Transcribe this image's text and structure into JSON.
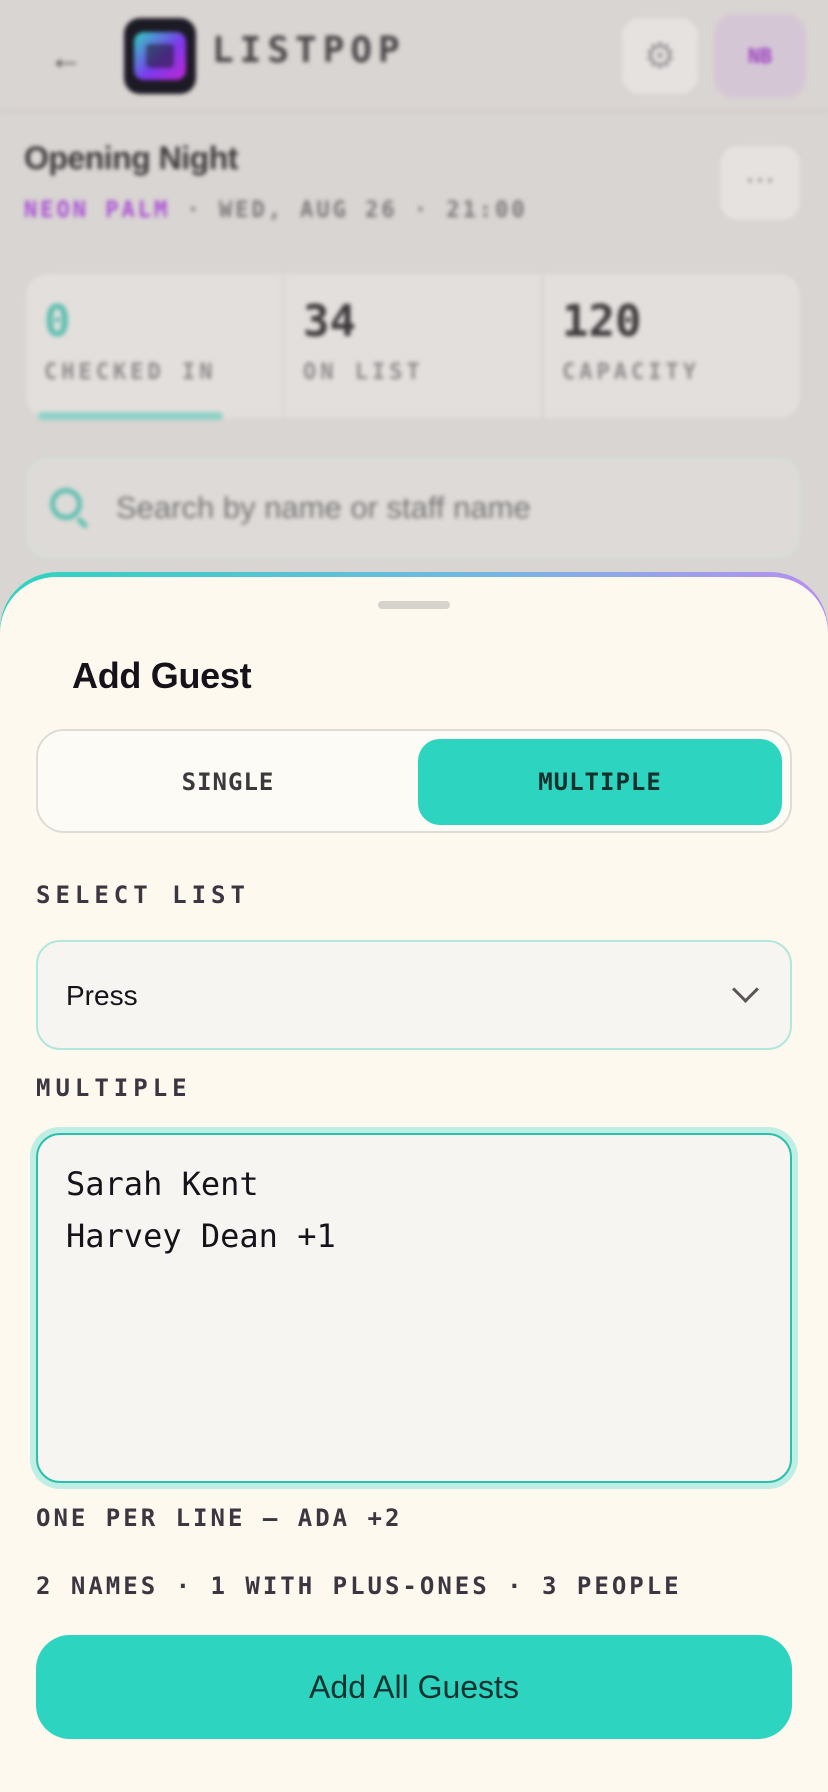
{
  "app": {
    "brand": "LISTPOP",
    "avatar_initials": "NB",
    "back_icon": "arrow-left-icon",
    "settings_icon": "gear-icon"
  },
  "event": {
    "title": "Opening Night",
    "venue": "NEON PALM",
    "meta": " · WED, AUG 26 · 21:00",
    "more_label": "⋯"
  },
  "stats": [
    {
      "value": "0",
      "label": "CHECKED IN"
    },
    {
      "value": "34",
      "label": "ON LIST"
    },
    {
      "value": "120",
      "label": "CAPACITY"
    }
  ],
  "progress": {
    "fraction": 0.25
  },
  "search": {
    "placeholder": "Search by name or staff name"
  },
  "sheet": {
    "title": "Add Guest",
    "modes": {
      "single": "SINGLE",
      "multiple": "MULTIPLE",
      "selected": "multiple"
    },
    "select_list_label": "SELECT LIST",
    "selected_list": "Press",
    "multiple_label": "MULTIPLE",
    "names": [
      "Sarah Kent",
      "Harvey Dean +1"
    ],
    "hint": "ONE PER LINE — ADA +2",
    "summary": "2 NAMES · 1 WITH PLUS-ONES · 3 PEOPLE",
    "submit_label": "Add All Guests"
  },
  "colors": {
    "accent": "#2dd4bf",
    "brand_purple": "#a94fd6",
    "sheet_bg": "#fdf9ef"
  }
}
